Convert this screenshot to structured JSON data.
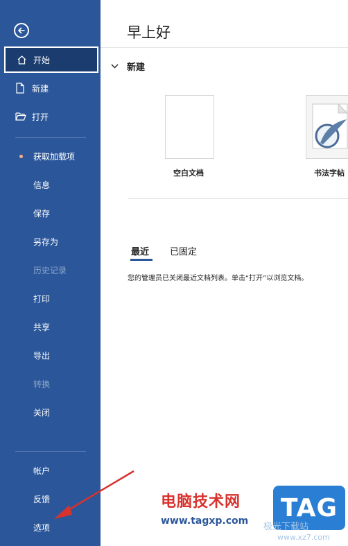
{
  "sidebar": {
    "items": [
      {
        "label": "开始",
        "icon": "home-icon",
        "active": true
      },
      {
        "label": "新建",
        "icon": "new-document-icon"
      },
      {
        "label": "打开",
        "icon": "folder-open-icon"
      },
      {
        "label": "获取加载项",
        "badge": true
      },
      {
        "label": "信息"
      },
      {
        "label": "保存"
      },
      {
        "label": "另存为"
      },
      {
        "label": "历史记录",
        "disabled": true
      },
      {
        "label": "打印"
      },
      {
        "label": "共享"
      },
      {
        "label": "导出"
      },
      {
        "label": "转换",
        "disabled": true
      },
      {
        "label": "关闭"
      },
      {
        "label": "帐户"
      },
      {
        "label": "反馈"
      },
      {
        "label": "选项"
      }
    ]
  },
  "main": {
    "greeting": "早上好",
    "new_section": "新建",
    "templates": [
      {
        "label": "空白文档"
      },
      {
        "label": "书法字帖"
      }
    ],
    "tabs": [
      {
        "label": "最近",
        "active": true
      },
      {
        "label": "已固定"
      }
    ],
    "recent_notice": "您的管理员已关闭最近文档列表。单击“打开”以浏览文档。"
  },
  "watermark": {
    "title": "电脑技术网",
    "url": "www.tagxp.com",
    "logo": "TAG",
    "faint": "极光下载站",
    "faint_url": "www.xz7.com"
  },
  "colors": {
    "sidebar": "#2b579a",
    "active_item": "#1a3c6e",
    "arrow": "#d8322d"
  }
}
